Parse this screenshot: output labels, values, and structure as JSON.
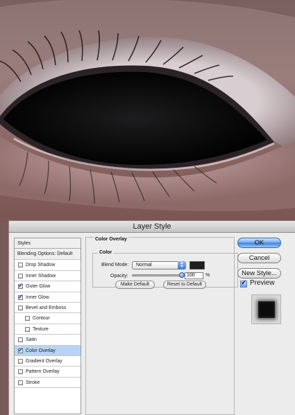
{
  "window": {
    "title": "Layer Style"
  },
  "styles_list": [
    {
      "label": "Styles",
      "kind": "head"
    },
    {
      "label": "Blending Options: Default",
      "kind": "blend"
    },
    {
      "label": "Drop Shadow",
      "checked": false
    },
    {
      "label": "Inner Shadow",
      "checked": false
    },
    {
      "label": "Outer Glow",
      "checked": true
    },
    {
      "label": "Inner Glow",
      "checked": true
    },
    {
      "label": "Bevel and Emboss",
      "checked": false
    },
    {
      "label": "Contour",
      "checked": false,
      "sub": true
    },
    {
      "label": "Texture",
      "checked": false,
      "sub": true
    },
    {
      "label": "Satin",
      "checked": false
    },
    {
      "label": "Color Overlay",
      "checked": true,
      "selected": true
    },
    {
      "label": "Gradient Overlay",
      "checked": false
    },
    {
      "label": "Pattern Overlay",
      "checked": false
    },
    {
      "label": "Stroke",
      "checked": false
    }
  ],
  "panel": {
    "title": "Color Overlay",
    "group_title": "Color",
    "blend_mode_label": "Blend Mode:",
    "blend_mode_value": "Normal",
    "overlay_color": "#1f1f1f",
    "opacity_label": "Opacity:",
    "opacity_value": "100",
    "opacity_unit": "%",
    "opacity_level": 1.0,
    "make_default": "Make Default",
    "reset_default": "Reset to Default"
  },
  "buttons": {
    "ok": "OK",
    "cancel": "Cancel",
    "new_style": "New Style...",
    "preview": "Preview",
    "preview_checked": true
  },
  "colors": {
    "accent": "#3b82dc",
    "selection": "#b7d4f5",
    "skin": "#8a6663",
    "pupil": "#050505"
  }
}
